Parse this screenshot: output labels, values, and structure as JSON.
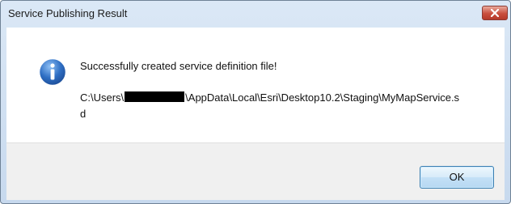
{
  "dialog": {
    "title": "Service Publishing Result",
    "icon": "info-icon",
    "message": "Successfully created service definition file!",
    "path_prefix": "C:\\Users\\",
    "path_suffix": "\\AppData\\Local\\Esri\\Desktop10.2\\Staging\\MyMapService.sd",
    "ok_label": "OK"
  },
  "colors": {
    "title_bar": "#c7d9ee",
    "close_button": "#c94f3e",
    "ok_button_border": "#3c7fb1",
    "info_icon": "#2f6fc4"
  }
}
